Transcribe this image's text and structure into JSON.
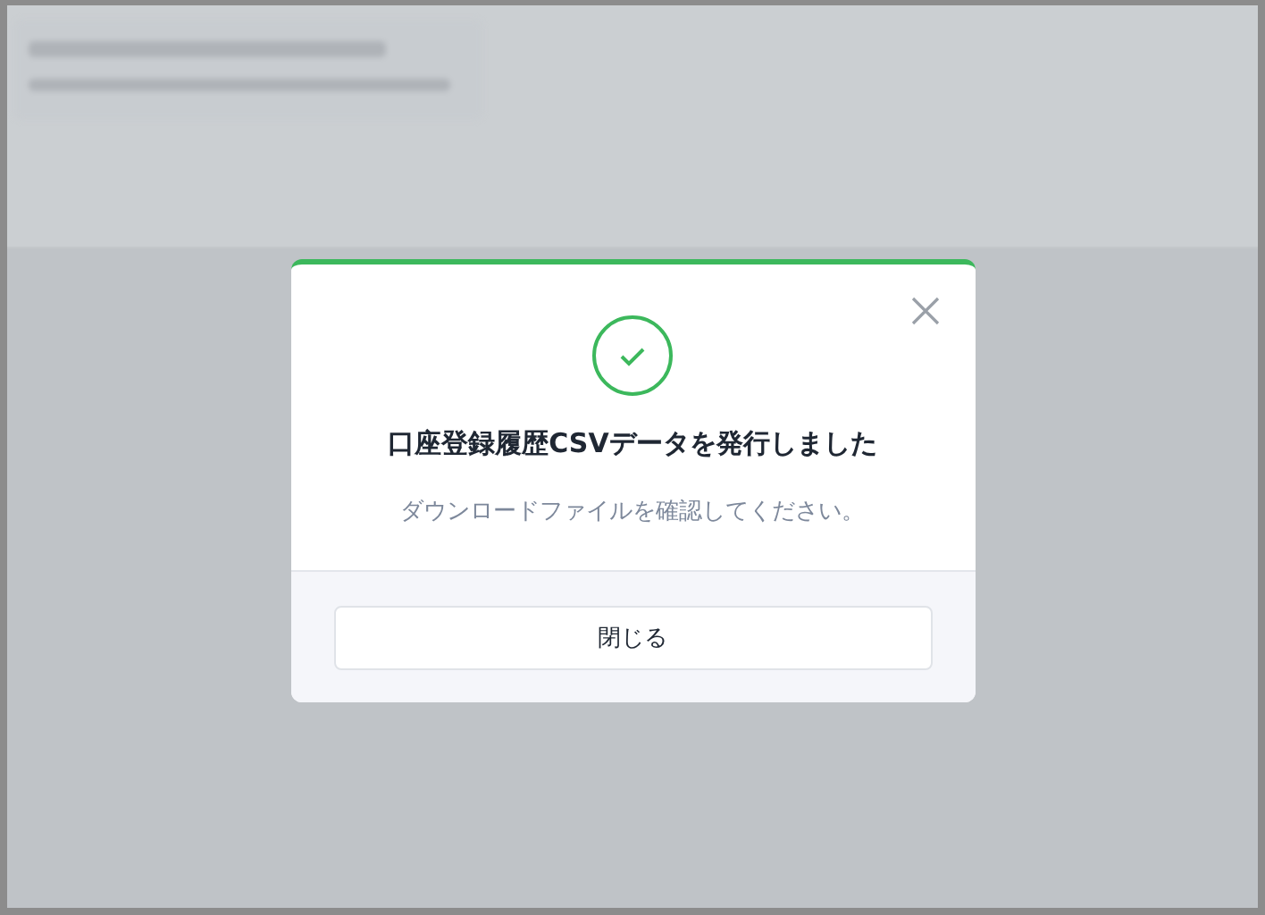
{
  "dialog": {
    "title": "口座登録履歴CSVデータを発行しました",
    "message": "ダウンロードファイルを確認してください。",
    "buttons": [
      "閉じる"
    ]
  }
}
